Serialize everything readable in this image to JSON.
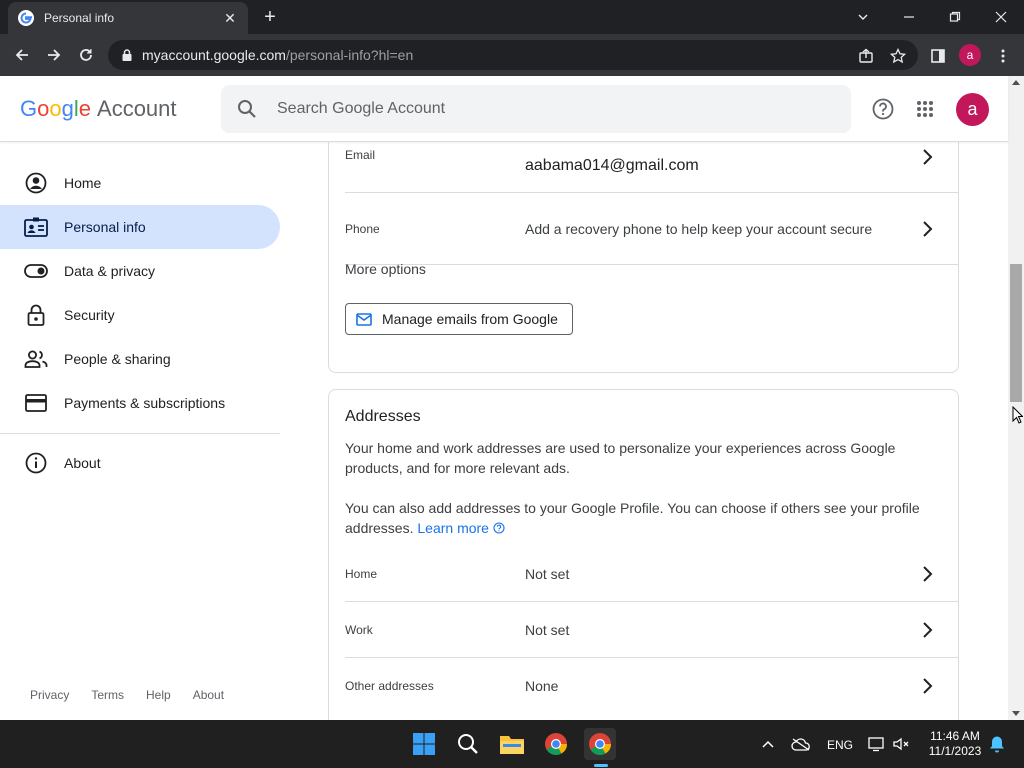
{
  "browser": {
    "tab_title": "Personal info",
    "url_host": "myaccount.google.com",
    "url_path": "/personal-info?hl=en",
    "profile_letter": "a"
  },
  "header": {
    "logo_letters": [
      "G",
      "o",
      "o",
      "g",
      "l",
      "e"
    ],
    "logo_suffix": "Account",
    "search_placeholder": "Search Google Account",
    "avatar_letter": "a"
  },
  "sidebar": {
    "items": [
      {
        "label": "Home",
        "icon": "account-circle-icon"
      },
      {
        "label": "Personal info",
        "icon": "id-card-icon"
      },
      {
        "label": "Data & privacy",
        "icon": "toggle-icon"
      },
      {
        "label": "Security",
        "icon": "lock-icon"
      },
      {
        "label": "People & sharing",
        "icon": "people-icon"
      },
      {
        "label": "Payments & subscriptions",
        "icon": "credit-card-icon"
      }
    ],
    "about": "About",
    "footer": [
      "Privacy",
      "Terms",
      "Help",
      "About"
    ]
  },
  "contact_card": {
    "email_label": "Email",
    "email_value": "aabama014@gmail.com",
    "phone_label": "Phone",
    "phone_value": "Add a recovery phone to help keep your account secure",
    "more_options": "More options",
    "manage_button": "Manage emails from Google"
  },
  "addresses_card": {
    "title": "Addresses",
    "desc1": "Your home and work addresses are used to personalize your experiences across Google products, and for more relevant ads.",
    "desc2": "You can also add addresses to your Google Profile. You can choose if others see your profile addresses.",
    "learn_more": "Learn more",
    "rows": [
      {
        "label": "Home",
        "value": "Not set"
      },
      {
        "label": "Work",
        "value": "Not set"
      },
      {
        "label": "Other addresses",
        "value": "None"
      }
    ]
  },
  "taskbar": {
    "language": "ENG",
    "time": "11:46 AM",
    "date": "11/1/2023"
  },
  "colors": {
    "active_nav": "#d3e3fd",
    "avatar": "#c2185b",
    "link": "#1a73e8"
  }
}
